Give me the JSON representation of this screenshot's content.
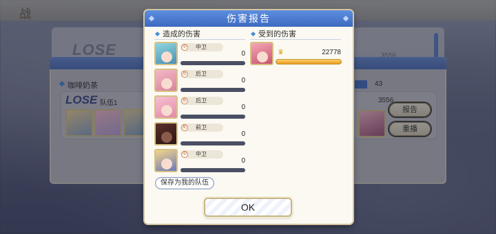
{
  "background": {
    "top_title": "战",
    "lose_label_top": "LOSE",
    "top_score": "3556",
    "record": {
      "player_name": "咖啡奶茶",
      "lose_label": "LOSE",
      "team_label": "队伍1",
      "score": "3556",
      "count": "43",
      "report_button": "报告",
      "replay_button": "重播"
    }
  },
  "modal": {
    "title": "伤害报告",
    "dealt_header": "造成的伤害",
    "taken_header": "受到的伤害",
    "dealt": [
      {
        "role": "中卫",
        "value": "0",
        "icon": "portrait-teal-hair",
        "fill": 0
      },
      {
        "role": "后卫",
        "value": "0",
        "icon": "portrait-pink-hair",
        "fill": 0
      },
      {
        "role": "后卫",
        "value": "0",
        "icon": "portrait-pink-long-hair",
        "fill": 0
      },
      {
        "role": "前卫",
        "value": "0",
        "icon": "portrait-dark-hair",
        "fill": 0
      },
      {
        "role": "中卫",
        "value": "0",
        "icon": "portrait-blonde-hair",
        "fill": 0
      }
    ],
    "taken": [
      {
        "value": "22778",
        "icon": "portrait-red-hair",
        "fill": 1.0
      }
    ],
    "save_team_button": "保存为我的队伍",
    "ok_button": "OK"
  }
}
